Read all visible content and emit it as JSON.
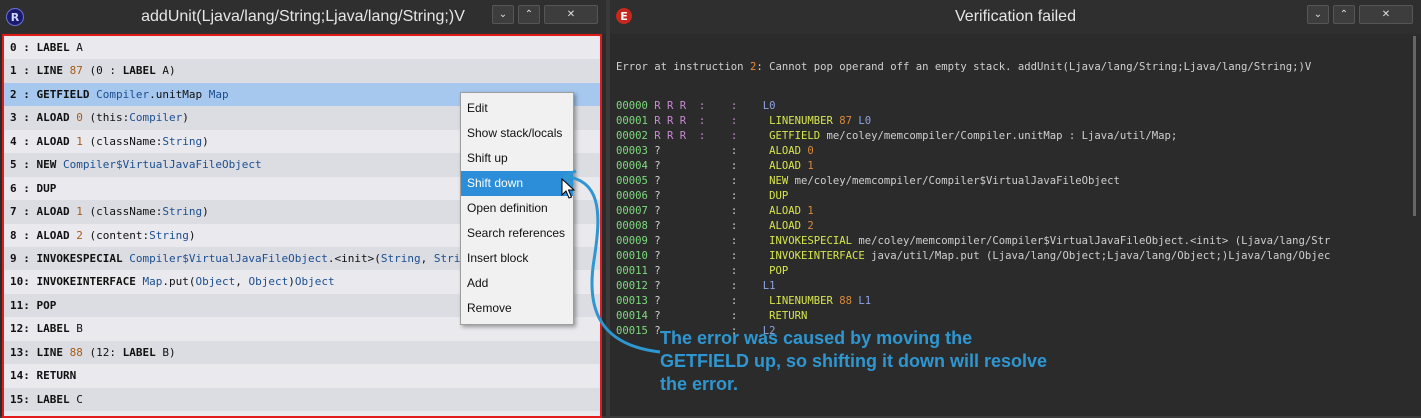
{
  "left_window": {
    "title": "addUnit(Ljava/lang/String;Ljava/lang/String;)V",
    "app_icon": "R",
    "instructions": [
      {
        "idx": "0",
        "op": "LABEL",
        "args": [
          {
            "t": "A",
            "c": ""
          }
        ]
      },
      {
        "idx": "1",
        "op": "LINE",
        "args": [
          {
            "t": "87",
            "c": "num"
          },
          {
            "t": " (0 : ",
            "c": ""
          },
          {
            "t": "LABEL",
            "c": "op"
          },
          {
            "t": " A)",
            "c": ""
          }
        ]
      },
      {
        "idx": "2",
        "op": "GETFIELD",
        "args": [
          {
            "t": "Compiler",
            "c": "blue"
          },
          {
            "t": ".unitMap ",
            "c": ""
          },
          {
            "t": "Map",
            "c": "blue"
          }
        ],
        "selected": true
      },
      {
        "idx": "3",
        "op": "ALOAD",
        "args": [
          {
            "t": "0",
            "c": "num"
          },
          {
            "t": " (this:",
            "c": ""
          },
          {
            "t": "Compiler",
            "c": "blue"
          },
          {
            "t": ")",
            "c": ""
          }
        ]
      },
      {
        "idx": "4",
        "op": "ALOAD",
        "args": [
          {
            "t": "1",
            "c": "num"
          },
          {
            "t": " (className:",
            "c": ""
          },
          {
            "t": "String",
            "c": "blue"
          },
          {
            "t": ")",
            "c": ""
          }
        ]
      },
      {
        "idx": "5",
        "op": "NEW",
        "args": [
          {
            "t": "Compiler$VirtualJavaFileObject",
            "c": "blue"
          }
        ]
      },
      {
        "idx": "6",
        "op": "DUP",
        "args": []
      },
      {
        "idx": "7",
        "op": "ALOAD",
        "args": [
          {
            "t": "1",
            "c": "num"
          },
          {
            "t": " (className:",
            "c": ""
          },
          {
            "t": "String",
            "c": "blue"
          },
          {
            "t": ")",
            "c": ""
          }
        ]
      },
      {
        "idx": "8",
        "op": "ALOAD",
        "args": [
          {
            "t": "2",
            "c": "num"
          },
          {
            "t": " (content:",
            "c": ""
          },
          {
            "t": "String",
            "c": "blue"
          },
          {
            "t": ")",
            "c": ""
          }
        ]
      },
      {
        "idx": "9",
        "op": "INVOKESPECIAL",
        "args": [
          {
            "t": "Compiler$VirtualJavaFileObject",
            "c": "blue"
          },
          {
            "t": ".<init>(",
            "c": ""
          },
          {
            "t": "String",
            "c": "blue"
          },
          {
            "t": ", ",
            "c": ""
          },
          {
            "t": "String",
            "c": "blue"
          }
        ]
      },
      {
        "idx": "10",
        "op": "INVOKEINTERFACE",
        "args": [
          {
            "t": "Map",
            "c": "blue"
          },
          {
            "t": ".put(",
            "c": ""
          },
          {
            "t": "Object",
            "c": "blue"
          },
          {
            "t": ", ",
            "c": ""
          },
          {
            "t": "Object",
            "c": "blue"
          },
          {
            "t": ")",
            "c": ""
          },
          {
            "t": "Object",
            "c": "blue"
          }
        ]
      },
      {
        "idx": "11",
        "op": "POP",
        "args": []
      },
      {
        "idx": "12",
        "op": "LABEL",
        "args": [
          {
            "t": "B",
            "c": ""
          }
        ]
      },
      {
        "idx": "13",
        "op": "LINE",
        "args": [
          {
            "t": "88",
            "c": "num"
          },
          {
            "t": " (12: ",
            "c": ""
          },
          {
            "t": "LABEL",
            "c": "op"
          },
          {
            "t": " B)",
            "c": ""
          }
        ]
      },
      {
        "idx": "14",
        "op": "RETURN",
        "args": []
      },
      {
        "idx": "15",
        "op": "LABEL",
        "args": [
          {
            "t": "C",
            "c": ""
          }
        ]
      }
    ]
  },
  "context_menu": {
    "items": [
      "Edit",
      "Show stack/locals",
      "Shift up",
      "Shift down",
      "Open definition",
      "Search references",
      "Insert block",
      "Add",
      "Remove"
    ],
    "highlighted": "Shift down"
  },
  "right_window": {
    "title": "Verification failed",
    "app_icon": "E",
    "error": {
      "prefix": "Error at instruction ",
      "index": "2",
      "suffix": ": Cannot pop operand off an empty stack. addUnit(Ljava/lang/String;Ljava/lang/String;)V"
    },
    "lines": [
      {
        "n": "00000",
        "frame": "R R R  :    :",
        "code": [
          {
            "t": "    L0",
            "c": "c-l"
          }
        ]
      },
      {
        "n": "00001",
        "frame": "R R R  :    :",
        "code": [
          {
            "t": "     LINENUMBER ",
            "c": "c-y"
          },
          {
            "t": "87",
            "c": "c-o"
          },
          {
            "t": " L0",
            "c": "c-l"
          }
        ]
      },
      {
        "n": "00002",
        "frame": "R R R  :    :",
        "code": [
          {
            "t": "     GETFIELD ",
            "c": "c-y"
          },
          {
            "t": "me/coley/memcompiler/Compiler.unitMap : Ljava/util/Map;",
            "c": "c-w"
          }
        ]
      },
      {
        "n": "00003",
        "frame": "?           :",
        "code": [
          {
            "t": "     ALOAD ",
            "c": "c-y"
          },
          {
            "t": "0",
            "c": "c-o"
          }
        ]
      },
      {
        "n": "00004",
        "frame": "?           :",
        "code": [
          {
            "t": "     ALOAD ",
            "c": "c-y"
          },
          {
            "t": "1",
            "c": "c-o"
          }
        ]
      },
      {
        "n": "00005",
        "frame": "?           :",
        "code": [
          {
            "t": "     NEW ",
            "c": "c-y"
          },
          {
            "t": "me/coley/memcompiler/Compiler$VirtualJavaFileObject",
            "c": "c-w"
          }
        ]
      },
      {
        "n": "00006",
        "frame": "?           :",
        "code": [
          {
            "t": "     DUP",
            "c": "c-y"
          }
        ]
      },
      {
        "n": "00007",
        "frame": "?           :",
        "code": [
          {
            "t": "     ALOAD ",
            "c": "c-y"
          },
          {
            "t": "1",
            "c": "c-o"
          }
        ]
      },
      {
        "n": "00008",
        "frame": "?           :",
        "code": [
          {
            "t": "     ALOAD ",
            "c": "c-y"
          },
          {
            "t": "2",
            "c": "c-o"
          }
        ]
      },
      {
        "n": "00009",
        "frame": "?           :",
        "code": [
          {
            "t": "     INVOKESPECIAL ",
            "c": "c-y"
          },
          {
            "t": "me/coley/memcompiler/Compiler$VirtualJavaFileObject.<init> (Ljava/lang/Str",
            "c": "c-w"
          }
        ]
      },
      {
        "n": "00010",
        "frame": "?           :",
        "code": [
          {
            "t": "     INVOKEINTERFACE ",
            "c": "c-y"
          },
          {
            "t": "java/util/Map.put (Ljava/lang/Object;Ljava/lang/Object;)Ljava/lang/Objec",
            "c": "c-w"
          }
        ]
      },
      {
        "n": "00011",
        "frame": "?           :",
        "code": [
          {
            "t": "     POP",
            "c": "c-y"
          }
        ]
      },
      {
        "n": "00012",
        "frame": "?           :",
        "code": [
          {
            "t": "    L1",
            "c": "c-l"
          }
        ]
      },
      {
        "n": "00013",
        "frame": "?           :",
        "code": [
          {
            "t": "     LINENUMBER ",
            "c": "c-y"
          },
          {
            "t": "88",
            "c": "c-o"
          },
          {
            "t": " L1",
            "c": "c-l"
          }
        ]
      },
      {
        "n": "00014",
        "frame": "?           :",
        "code": [
          {
            "t": "     RETURN",
            "c": "c-y"
          }
        ]
      },
      {
        "n": "00015",
        "frame": "?           :",
        "code": [
          {
            "t": "    L2",
            "c": "c-l"
          }
        ]
      }
    ]
  },
  "annotation": {
    "text": "The error was caused by moving the GETFIELD up, so shifting it down will resolve the error.",
    "color": "#2e96d0"
  },
  "window_buttons": [
    "⌄",
    "⌃",
    "✕"
  ]
}
